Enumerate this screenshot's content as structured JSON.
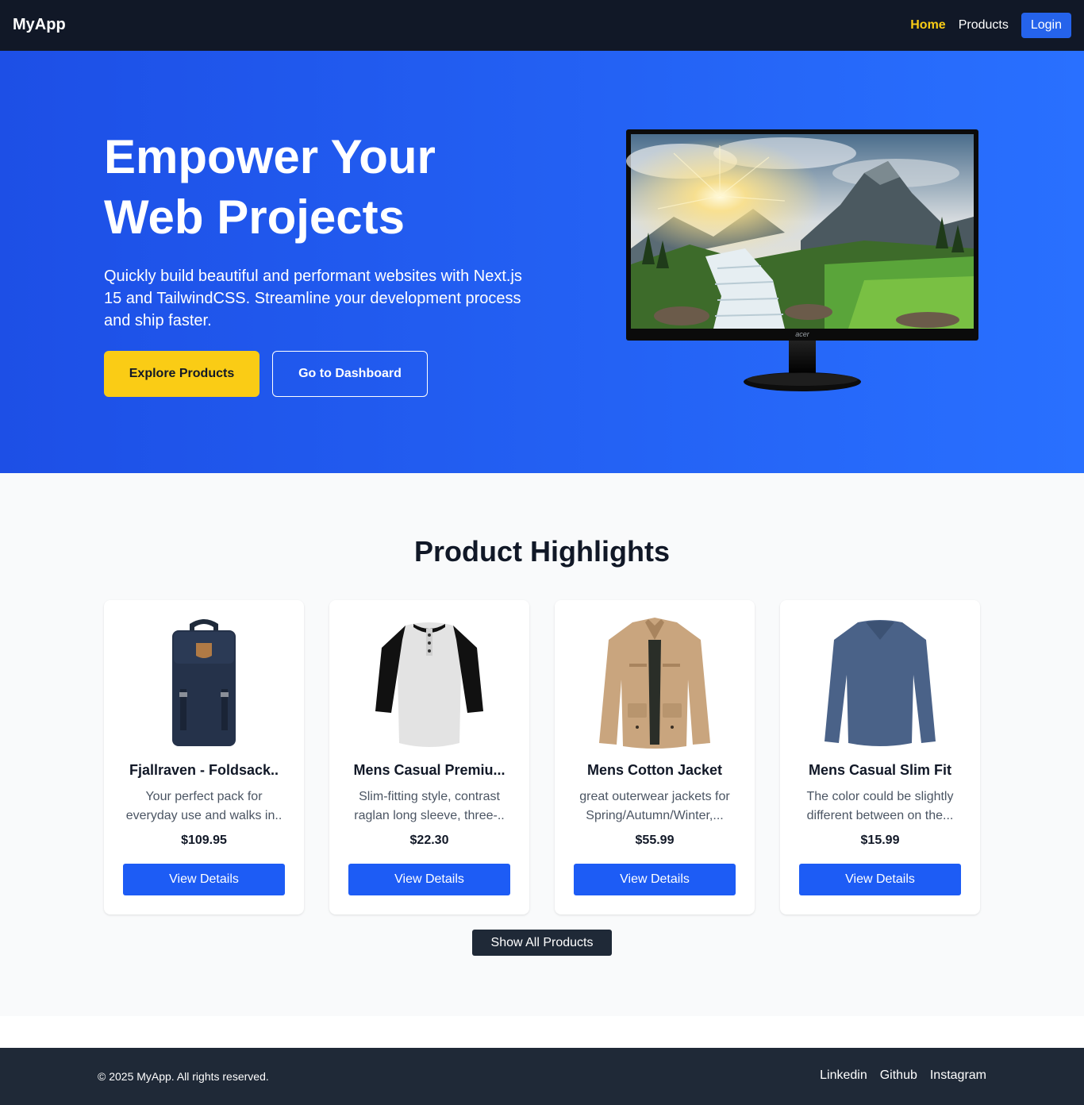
{
  "nav": {
    "brand": "MyApp",
    "links": [
      {
        "label": "Home",
        "active": true
      },
      {
        "label": "Products",
        "active": false
      }
    ],
    "login_label": "Login"
  },
  "hero": {
    "title_line1": "Empower Your",
    "title_line2": "Web Projects",
    "subtitle": "Quickly build beautiful and performant websites with Next.js 15 and TailwindCSS. Streamline your development process and ship faster.",
    "primary_cta": "Explore Products",
    "secondary_cta": "Go to Dashboard",
    "monitor_brand": "acer"
  },
  "products": {
    "title": "Product Highlights",
    "items": [
      {
        "name": "Fjallraven - Foldsack..",
        "description": "Your perfect pack for everyday use and walks in..",
        "price": "$109.95",
        "button": "View Details",
        "image": "backpack"
      },
      {
        "name": "Mens Casual Premiu...",
        "description": "Slim-fitting style, contrast raglan long sleeve, three-..",
        "price": "$22.30",
        "button": "View Details",
        "image": "raglan-tshirt"
      },
      {
        "name": "Mens Cotton Jacket",
        "description": "great outerwear jackets for Spring/Autumn/Winter,...",
        "price": "$55.99",
        "button": "View Details",
        "image": "cotton-jacket"
      },
      {
        "name": "Mens Casual Slim Fit",
        "description": "The color could be slightly different between on the...",
        "price": "$15.99",
        "button": "View Details",
        "image": "long-sleeve-shirt"
      }
    ],
    "show_all": "Show All Products"
  },
  "footer": {
    "copyright": "© 2025 MyApp. All rights reserved.",
    "links": [
      "Linkedin",
      "Github",
      "Instagram"
    ]
  },
  "colors": {
    "nav_bg": "#111827",
    "accent_yellow": "#facc15",
    "primary_blue": "#2563eb",
    "hero_gradient_start": "#1d4fe6",
    "hero_gradient_end": "#2970ff",
    "footer_bg": "#1f2937"
  }
}
